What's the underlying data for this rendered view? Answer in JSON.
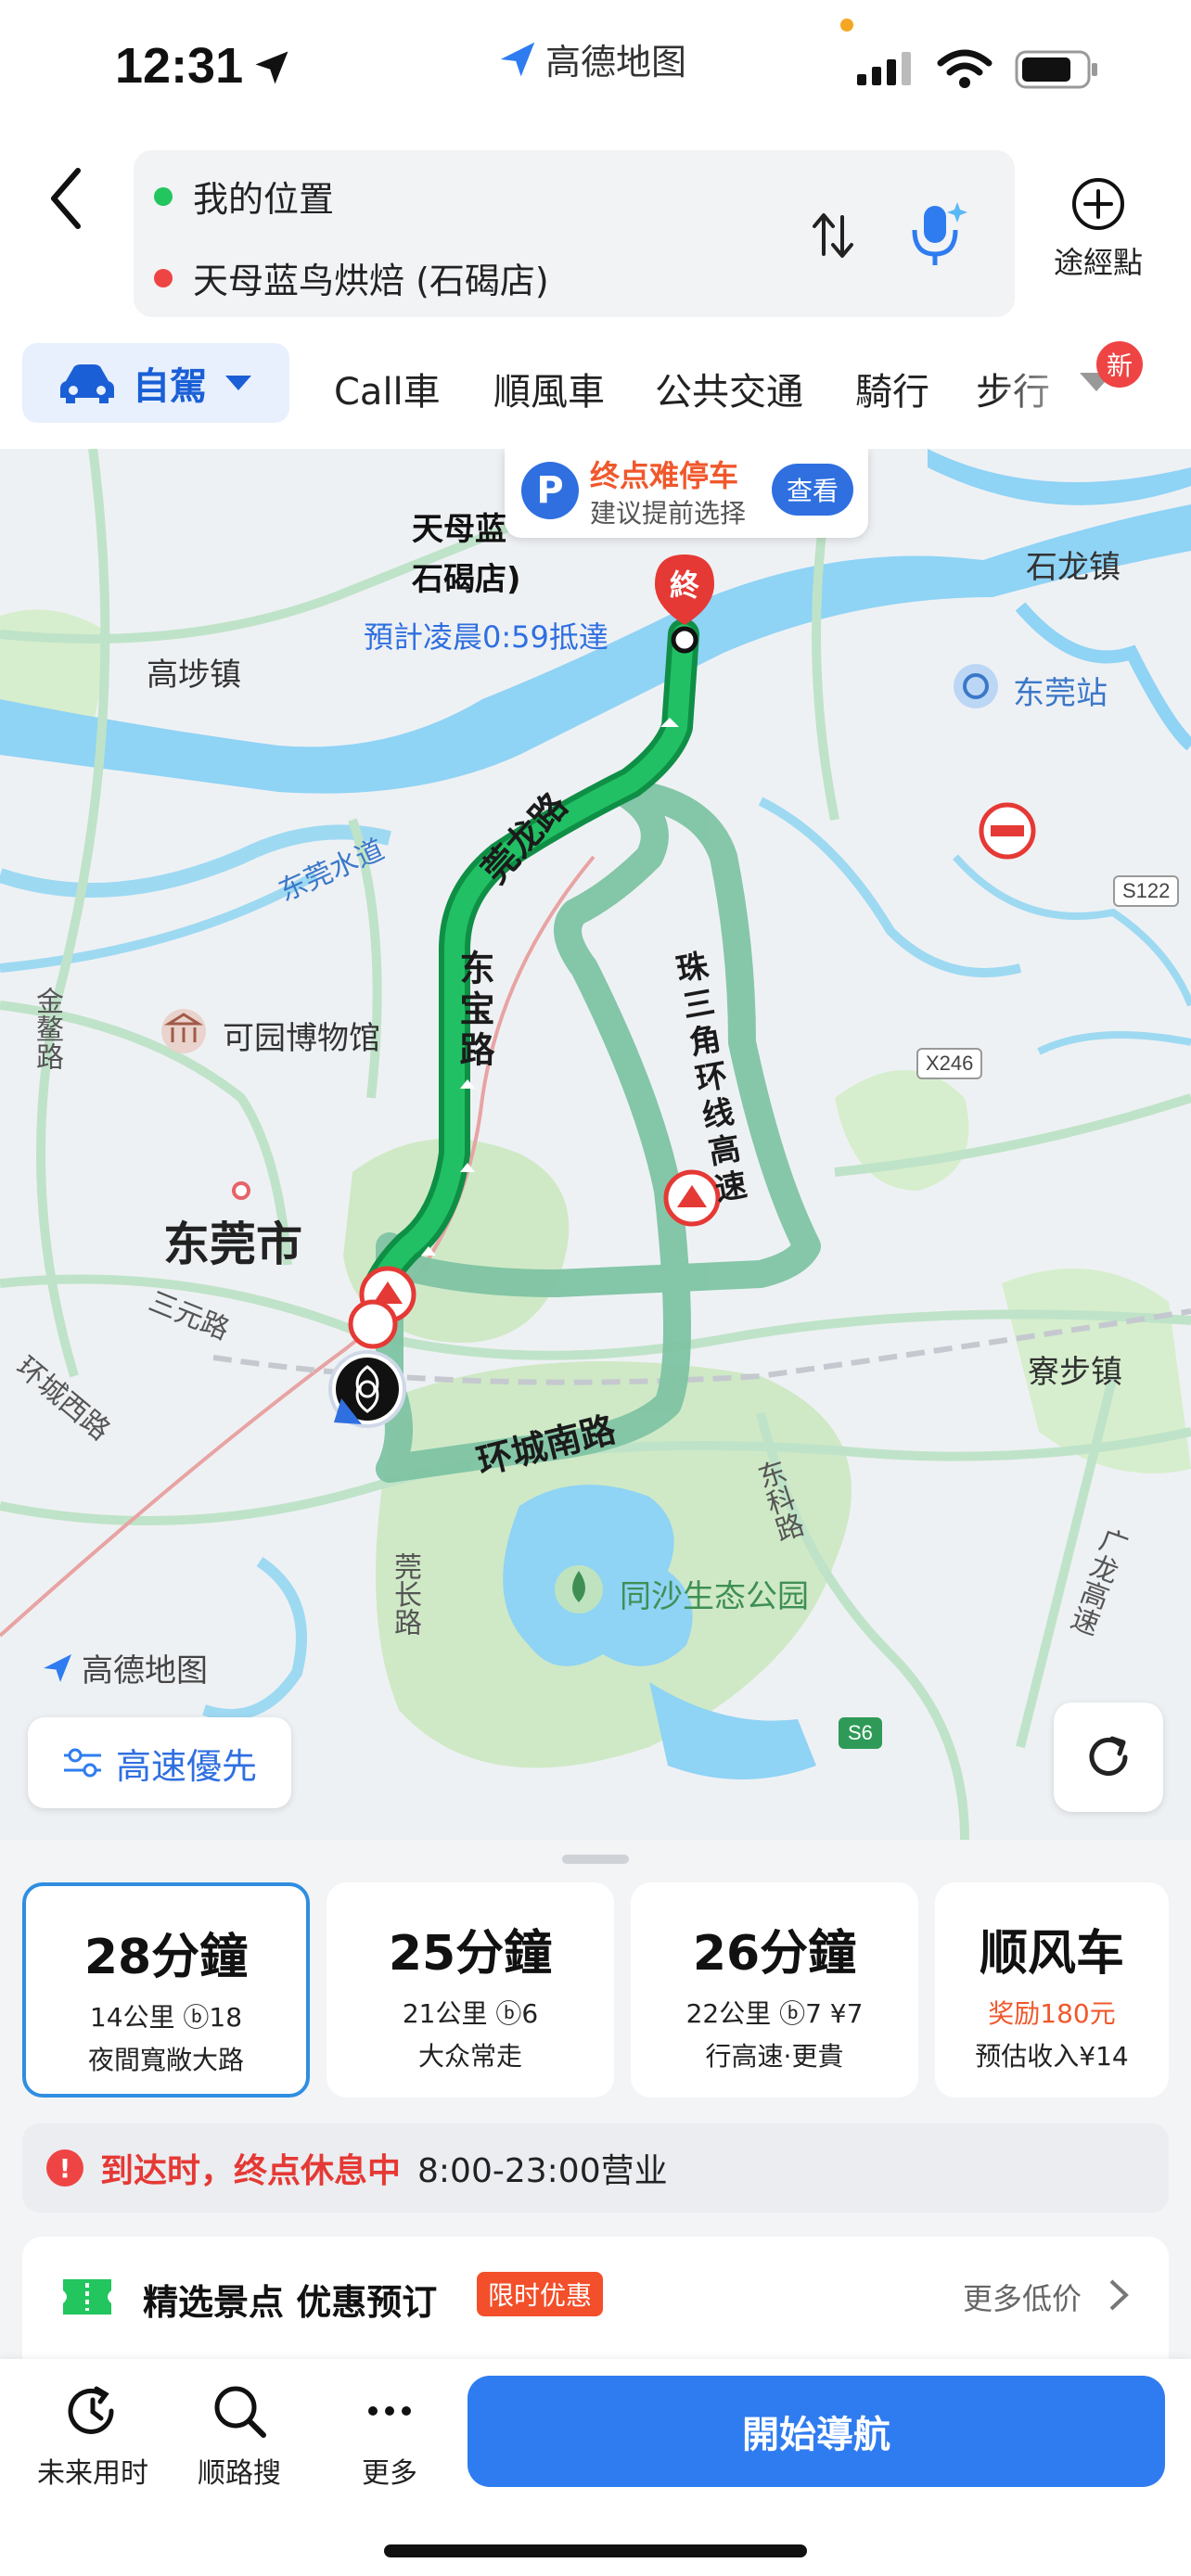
{
  "status_bar": {
    "time": "12:31",
    "app_name": "高德地图"
  },
  "header": {
    "origin": "我的位置",
    "destination": "天母蓝鸟烘焙 (石碣店)",
    "waypoint_label": "途經點"
  },
  "modes": {
    "selected": "自駕",
    "tabs": [
      "Call車",
      "順風車",
      "公共交通",
      "騎行",
      "步行"
    ],
    "new_badge": "新"
  },
  "map": {
    "parking_notice": {
      "title": "终点难停车",
      "subtitle": "建议提前选择",
      "button": "查看"
    },
    "dest_name_line1": "天母蓝",
    "dest_name_line2": "石碣店)",
    "end_pin": "終",
    "eta": "預計凌晨0:59抵達",
    "place_labels": {
      "gaobu": "高埗镇",
      "shilong": "石龙镇",
      "dongguan_station": "东莞站",
      "keyuan_museum": "可园博物馆",
      "dongguan_city": "东莞市",
      "liaobu": "寮步镇",
      "tongsha_park": "同沙生态公园",
      "dongguan_waterway": "东莞水道",
      "sanyuan_rd": "三元路",
      "huancheng_west": "环城西路",
      "jinao_rd": "金鳌路",
      "guanchang_rd": "莞长路",
      "dongke_rd": "东科路",
      "guanglong_hwy": "广龙高速"
    },
    "road_labels": {
      "guanlong": "莞龙路",
      "dongbao": "东宝路",
      "zhusanjiao": "珠三角环线高速",
      "huanchengnan": "环城南路"
    },
    "shields": [
      "S122",
      "X246",
      "S6"
    ],
    "watermark": "高德地图",
    "highway_pref": "高速優先"
  },
  "routes": [
    {
      "time": "28分鐘",
      "info": "14公里 ⓑ18",
      "desc": "夜間寬敞大路",
      "selected": true
    },
    {
      "time": "25分鐘",
      "info": "21公里 ⓑ6",
      "desc": "大众常走",
      "selected": false
    },
    {
      "time": "26分鐘",
      "info": "22公里 ⓑ7 ¥7",
      "desc": "行高速·更貴",
      "selected": false
    },
    {
      "time": "顺风车",
      "info": "奖励180元",
      "desc": "预估收入¥14",
      "selected": false
    }
  ],
  "notice": {
    "warning": "到达时，终点休息中",
    "hours": "8:00-23:00营业"
  },
  "promo": {
    "title": "精选景点 优惠预订",
    "tag": "限时优惠",
    "more": "更多低价"
  },
  "bottom_bar": {
    "future": "未来用时",
    "along_search": "顺路搜",
    "more": "更多",
    "start": "開始導航"
  },
  "colors": {
    "accent": "#2f7cf0",
    "route_main": "#1aa35a",
    "route_alt": "#7fc4a4",
    "warning": "#e53935"
  }
}
